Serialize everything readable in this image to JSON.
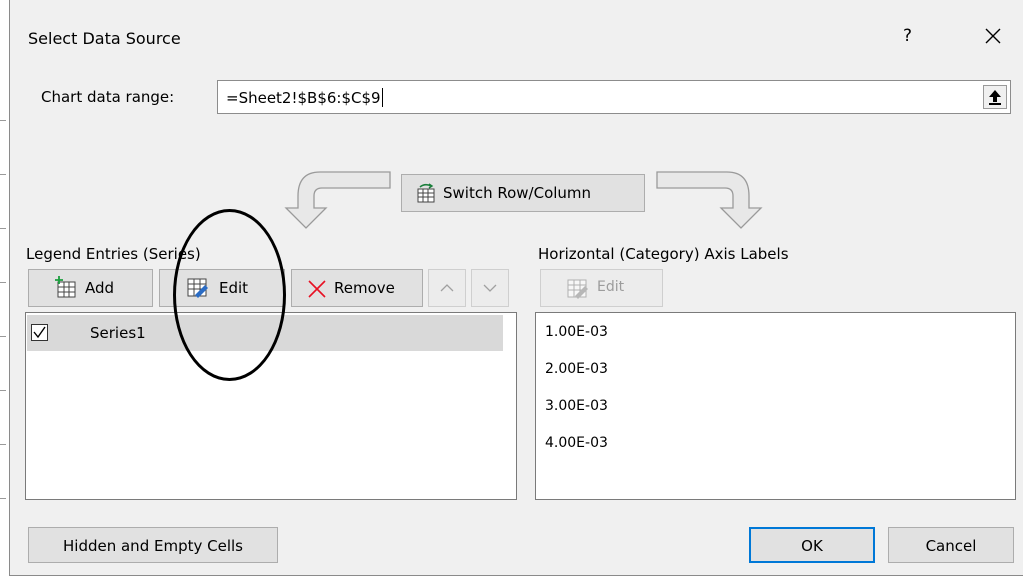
{
  "dialog": {
    "title": "Select Data Source",
    "help": "?",
    "close_icon": "close-icon"
  },
  "range": {
    "label": "Chart data range:",
    "value": "=Sheet2!$B$6:$C$9",
    "collapse_icon": "upload-arrow-icon"
  },
  "switch_button": {
    "label": "Switch Row/Column",
    "icon": "switch-row-column-icon"
  },
  "legend": {
    "label": "Legend Entries (Series)",
    "buttons": {
      "add": "Add",
      "edit": "Edit",
      "remove": "Remove"
    },
    "series": [
      {
        "name": "Series1",
        "checked": true
      }
    ]
  },
  "axis": {
    "label": "Horizontal (Category) Axis Labels",
    "edit": "Edit",
    "items": [
      "1.00E-03",
      "2.00E-03",
      "3.00E-03",
      "4.00E-03"
    ]
  },
  "footer": {
    "hidden_cells": "Hidden and Empty Cells",
    "ok": "OK",
    "cancel": "Cancel"
  },
  "colors": {
    "accent": "#0078d7",
    "remove_x": "#e81123",
    "dialog_bg": "#f0f0f0"
  }
}
